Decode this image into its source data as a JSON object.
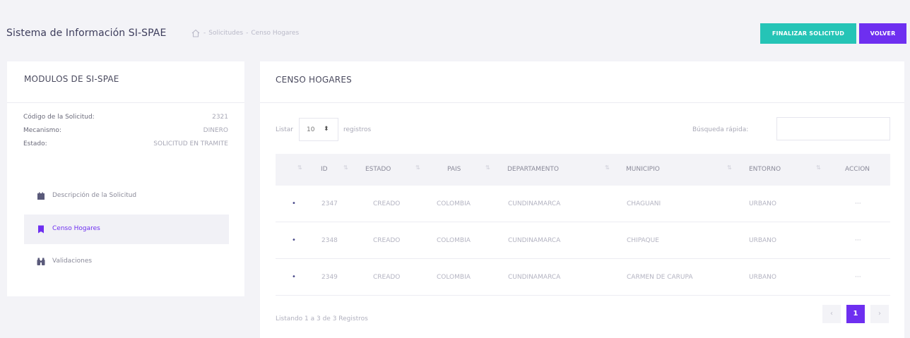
{
  "header": {
    "title": "Sistema de Información SI-SPAE",
    "breadcrumb": [
      "Solicitudes",
      "Censo Hogares"
    ],
    "buttons": {
      "finalize": "FINALIZAR SOLICITUD",
      "back": "VOLVER"
    }
  },
  "sidebar": {
    "title": "MODULOS DE SI-SPAE",
    "info": [
      {
        "label": "Código de la Solicitud:",
        "value": "2321"
      },
      {
        "label": "Mecanismo:",
        "value": "DINERO"
      },
      {
        "label": "Estado:",
        "value": "SOLICITUD EN TRAMITE"
      }
    ],
    "menu": [
      {
        "label": "Descripción de la Solicitud",
        "icon": "calendar-icon"
      },
      {
        "label": "Censo Hogares",
        "icon": "bookmark-icon",
        "active": true
      },
      {
        "label": "Validaciones",
        "icon": "binoculars-icon"
      }
    ]
  },
  "main": {
    "title": "CENSO HOGARES",
    "length_label_before": "Listar",
    "length_value": "10",
    "length_label_after": "registros",
    "search_label": "Búsqueda rápida:",
    "columns": [
      "ID",
      "ESTADO",
      "PAIS",
      "DEPARTAMENTO",
      "MUNICIPIO",
      "ENTORNO",
      "ACCION"
    ],
    "rows": [
      {
        "id": "2347",
        "estado": "CREADO",
        "pais": "COLOMBIA",
        "departamento": "CUNDINAMARCA",
        "municipio": "CHAGUANI",
        "entorno": "URBANO",
        "accion": "···"
      },
      {
        "id": "2348",
        "estado": "CREADO",
        "pais": "COLOMBIA",
        "departamento": "CUNDINAMARCA",
        "municipio": "CHIPAQUE",
        "entorno": "URBANO",
        "accion": "···"
      },
      {
        "id": "2349",
        "estado": "CREADO",
        "pais": "COLOMBIA",
        "departamento": "CUNDINAMARCA",
        "municipio": "CARMEN DE CARUPA",
        "entorno": "URBANO",
        "accion": "···"
      }
    ],
    "info_text": "Listando 1 a 3 de 3 Registros",
    "pagination": {
      "prev": "‹",
      "current": "1",
      "next": "›"
    }
  },
  "colors": {
    "accent": "#6e2ff0",
    "teal": "#25c4b6"
  }
}
